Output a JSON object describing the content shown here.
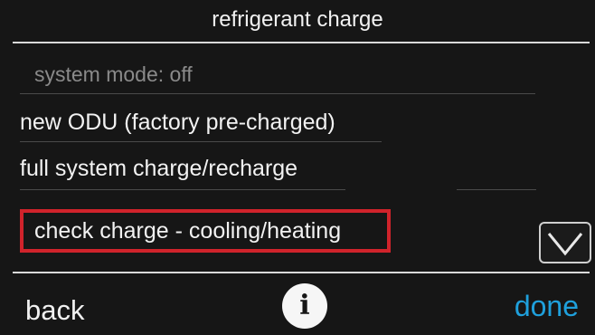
{
  "header": {
    "title": "refrigerant charge"
  },
  "menu": {
    "items": [
      {
        "label": "system mode: off"
      },
      {
        "label": "new ODU (factory pre-charged)"
      },
      {
        "label": "full system charge/recharge"
      },
      {
        "label": "check charge - cooling/heating"
      }
    ]
  },
  "footer": {
    "back_label": "back",
    "info_glyph": "i",
    "done_label": "done"
  },
  "colors": {
    "background": "#161616",
    "text": "#f2f2f2",
    "disabled_text": "#8a8a8a",
    "highlight": "#d0232b",
    "accent": "#1fa0dc"
  },
  "icons": [
    "chevron-down-icon",
    "info-icon"
  ]
}
